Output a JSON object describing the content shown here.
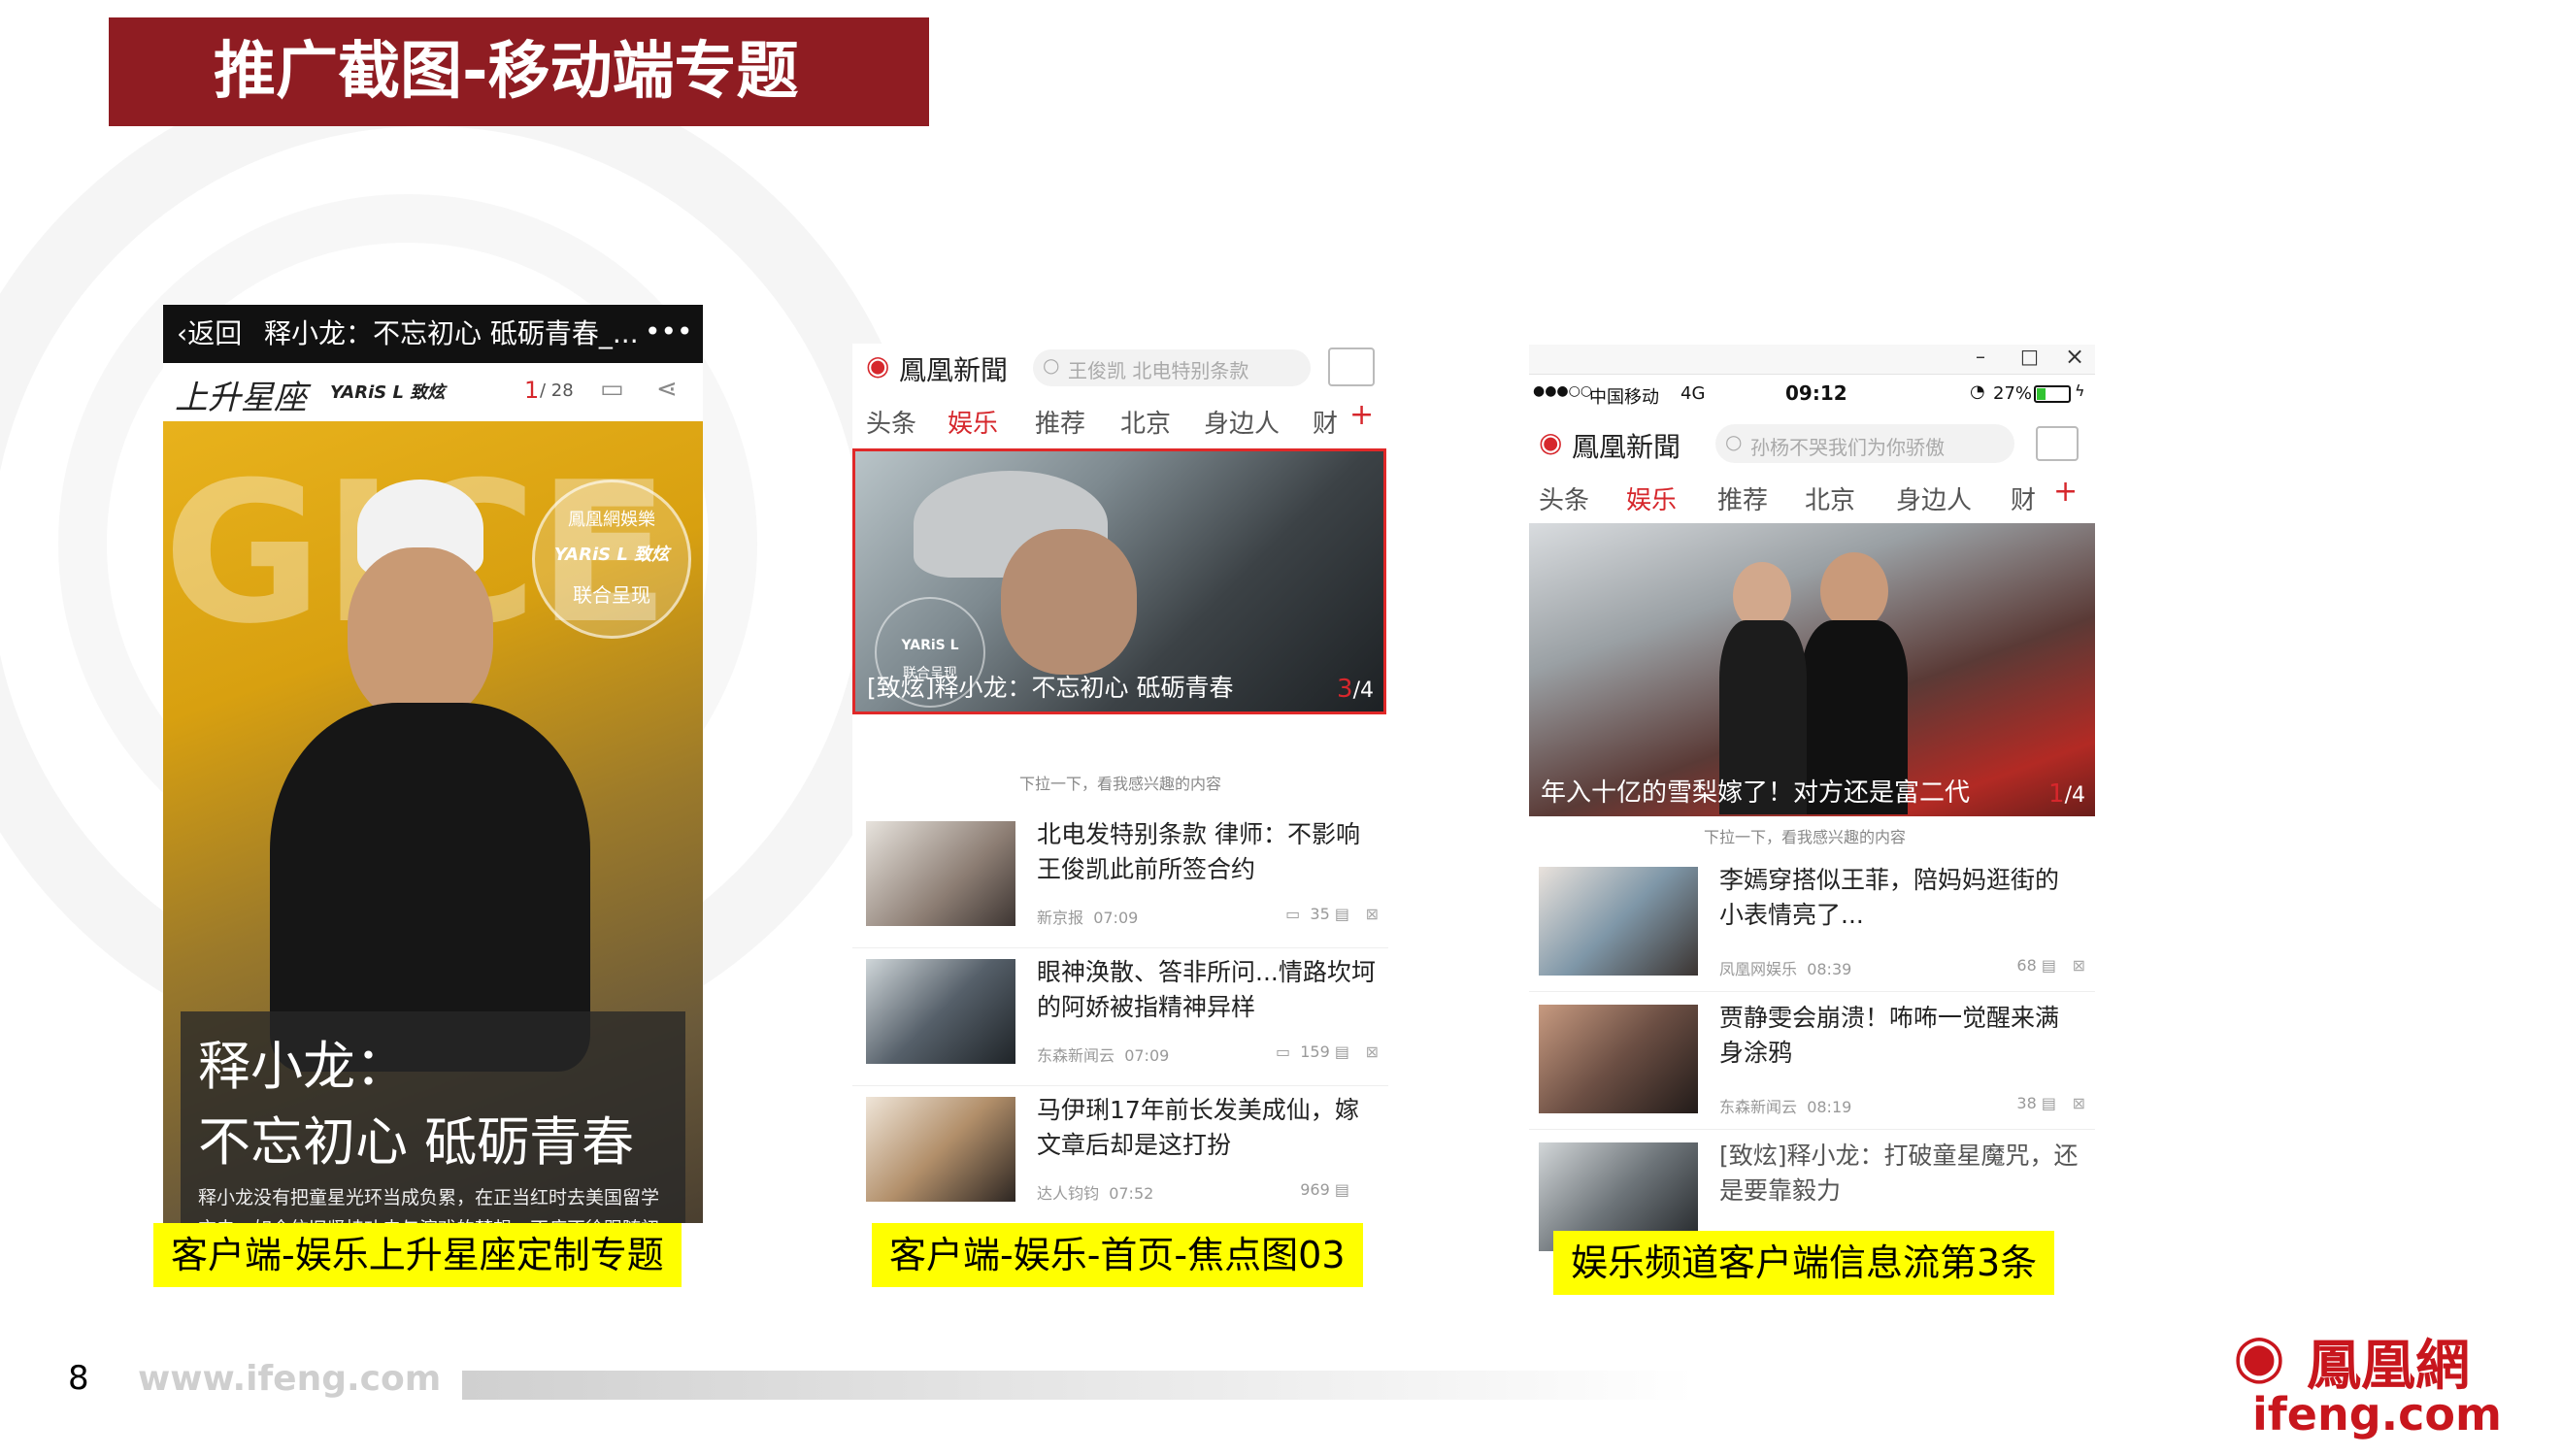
{
  "slide": {
    "title": "推广截图-移动端专题",
    "page_number": "8",
    "footer_url": "www.ifeng.com",
    "logo_cn": "鳳凰網",
    "logo_en": "ifeng.com",
    "accent_color": "#8f1c22"
  },
  "panel1": {
    "back_label": "返回",
    "title": "释小龙：不忘初心 砥砺青春_...",
    "more": "•••",
    "brand": "上升星座",
    "sponsor": "YARiS L 致炫",
    "page_current": "1",
    "page_total": "/ 28",
    "badge_brand": "鳳凰網娛樂",
    "badge_sponsor": "YARiS L 致炫",
    "badge_text": "联合呈现",
    "headline1": "释小龙：",
    "headline2": "不忘初心 砥砺青春",
    "body": "释小龙没有把童星光环当成负累，在正当红时去美国留学充电，如今依旧坚持功夫与演戏的梦想，不疾不徐跟随初心，将青春活成自己想要的样子。",
    "caption": "客户端-娱乐上升星座定制专题"
  },
  "panel2": {
    "app_name": "鳳凰新聞",
    "search_placeholder": "王俊凯 北电特别条款",
    "tabs": [
      "头条",
      "娱乐",
      "推荐",
      "北京",
      "身边人",
      "财"
    ],
    "plus": "+",
    "hero_caption": "[致炫]释小龙：不忘初心 砥砺青春",
    "hero_page_current": "3",
    "hero_page_total": "/4",
    "badge_sponsor": "YARiS L",
    "badge_text": "联合呈现",
    "pull_hint": "下拉一下，看我感兴趣的内容",
    "items": [
      {
        "title": "北电发特别条款 律师：不影响王俊凯此前所签合约",
        "source": "新京报",
        "time": "07:09",
        "count": "35"
      },
      {
        "title": "眼神涣散、答非所问...情路坎坷的阿娇被指精神异样",
        "source": "东森新闻云",
        "time": "07:09",
        "count": "159"
      },
      {
        "title": "马伊琍17年前长发美成仙，嫁文章后却是这打扮",
        "source": "达人钧钧",
        "time": "07:52",
        "count": "969"
      }
    ],
    "caption": "客户端-娱乐-首页-焦点图03"
  },
  "panel3": {
    "window_min": "–",
    "window_max": "□",
    "window_close": "×",
    "signal": "●●●○○",
    "carrier": "中国移动",
    "network": "4G",
    "clock": "09:12",
    "battery": "27%",
    "app_name": "鳳凰新聞",
    "search_placeholder": "孙杨不哭我们为你骄傲",
    "tabs": [
      "头条",
      "娱乐",
      "推荐",
      "北京",
      "身边人",
      "财"
    ],
    "plus": "+",
    "hero_caption": "年入十亿的雪梨嫁了！对方还是富二代",
    "hero_page_current": "1",
    "hero_page_total": "/4",
    "pull_hint": "下拉一下，看我感兴趣的内容",
    "items": [
      {
        "title": "李嫣穿搭似王菲，陪妈妈逛街的小表情亮了...",
        "source": "凤凰网娱乐",
        "time": "08:39",
        "count": "68"
      },
      {
        "title": "贾静雯会崩溃！咘咘一觉醒来满身涂鸦",
        "source": "东森新闻云",
        "time": "08:19",
        "count": "38"
      },
      {
        "title": "[致炫]释小龙：打破童星魔咒，还是要靠毅力",
        "source": "",
        "time": "",
        "count": ""
      }
    ],
    "caption": "娱乐频道客户端信息流第3条"
  }
}
